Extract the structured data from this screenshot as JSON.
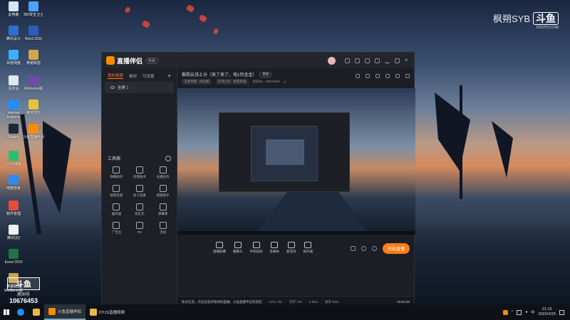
{
  "desktop": {
    "watermark_name": "枫朔SYB",
    "watermark_logo": "斗鱼",
    "watermark_site": "DOUYU.COM",
    "room_logo": "斗鱼",
    "room_label": "房间号",
    "room_number": "10676453",
    "icons": [
      {
        "label": "此电脑",
        "color": "#cfe8ff"
      },
      {
        "label": "360安全卫士",
        "color": "#4aa3ff"
      },
      {
        "label": "腾讯设计",
        "color": "#2a6fd1"
      },
      {
        "label": "Word 2010",
        "color": "#2b5cb8"
      },
      {
        "label": "百度网盘",
        "color": "#3ab0ff"
      },
      {
        "label": "英雄联盟",
        "color": "#d2a84a"
      },
      {
        "label": "回收站",
        "color": "#dfe7f0"
      },
      {
        "label": "WeGame版",
        "color": "#6f4aa8"
      },
      {
        "label": "Internet Explorer",
        "color": "#1e90ff"
      },
      {
        "label": "绝地求生",
        "color": "#e9c23a"
      },
      {
        "label": "Steam",
        "color": "#1b2838"
      },
      {
        "label": "斗鱼直播伴侣",
        "color": "#ff8a00"
      },
      {
        "label": "UU加速器",
        "color": "#2dbd6e"
      },
      {
        "label": "电脑管家",
        "color": "#2a8bf2"
      },
      {
        "label": "软件管理",
        "color": "#e84b3c"
      },
      {
        "label": "腾讯QQ",
        "color": "#f0f0f0"
      },
      {
        "label": "Excel 2010",
        "color": "#217346"
      },
      {
        "label": "英雄联盟WeGame版",
        "color": "#c9a24a"
      }
    ]
  },
  "app": {
    "name": "直播伴侣",
    "version": "新版",
    "sidebar_tabs": [
      "我的场景",
      "素材",
      "可设置"
    ],
    "scene_name": "全屏 1",
    "toolbox_title": "工具箱",
    "tools": [
      "弹幕助手",
      "房管助手",
      "主播任务",
      "视频连麦",
      "多人连麦",
      "感谢助手",
      "抽奖器",
      "抢红包",
      "弹幕库",
      "广告位",
      "PK",
      "活动"
    ],
    "room_title": "枫朔云顶上分（来了来了，电1你金金）",
    "edit_btn": "修改",
    "meta_chip1": "王者荣耀 · 排位赛",
    "meta_chip2": "云顶之弈 · 极客英雄",
    "room_id": "房间ID：10676453",
    "viewers": "0",
    "controls": [
      "直播屏幕",
      "摄像头",
      "手机投屏",
      "多媒体",
      "麦克风",
      "扬声器"
    ],
    "start_label": "开始直播",
    "status_notice": "私有信息，点击此处开始你的直播，斗鱼直播平台欢迎您",
    "status_stats": [
      "CPU: 0%",
      "内存: 0%",
      "0 kb/s",
      "帧率 0/30"
    ],
    "rec_time": "00:00:00"
  },
  "taskbar": {
    "tasks": [
      {
        "label": "斗鱼直播伴侣",
        "active": true,
        "color": "#ff8a00"
      },
      {
        "label": "DYJS直播视频",
        "active": false,
        "color": "#e8b74a"
      }
    ],
    "time": "21:15",
    "date": "2022/4/26"
  }
}
